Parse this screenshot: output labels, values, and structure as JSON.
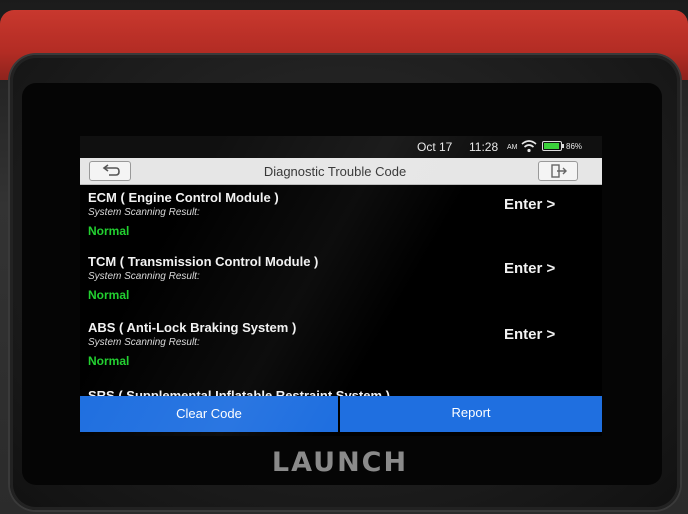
{
  "status_bar": {
    "date": "Oct 17",
    "time": "11:28",
    "ampm": "AM",
    "battery_pct": "86%",
    "icons": [
      "wifi-icon",
      "battery-icon"
    ]
  },
  "title_bar": {
    "title": "Diagnostic Trouble Code",
    "back_icon": "back-arrow-icon",
    "exit_icon": "exit-icon"
  },
  "modules": [
    {
      "name": "ECM ( Engine Control Module )",
      "scan_label": "System Scanning Result:",
      "status": "Normal",
      "action": "Enter >"
    },
    {
      "name": "TCM ( Transmission Control Module )",
      "scan_label": "System Scanning Result:",
      "status": "Normal",
      "action": "Enter >"
    },
    {
      "name": "ABS ( Anti-Lock Braking System )",
      "scan_label": "System Scanning Result:",
      "status": "Normal",
      "action": "Enter >"
    },
    {
      "name": "SRS ( Supplemental Inflatable Restraint System )",
      "scan_label": "",
      "status": "",
      "action": ""
    }
  ],
  "bottom_bar": {
    "clear_code": "Clear Code",
    "report": "Report"
  },
  "device": {
    "brand": "LAUNCH"
  },
  "colors": {
    "accent_blue": "#1f6fe0",
    "status_normal": "#22d030",
    "housing_red": "#c8382e"
  }
}
